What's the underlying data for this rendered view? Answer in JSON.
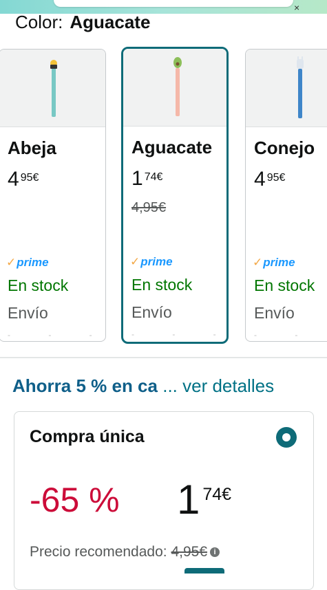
{
  "header": {
    "close_glyph": "×"
  },
  "color_selector": {
    "label": "Color:",
    "value": "Aguacate"
  },
  "variants": [
    {
      "name": "Abeja",
      "price_whole": "4",
      "price_frac": "95€",
      "strike_price": "",
      "prime": "prime",
      "stock": "En stock",
      "shipping": "Envío",
      "pen_color": "#78c8c4",
      "cap_color": "#f2c23a"
    },
    {
      "name": "Aguacate",
      "price_whole": "1",
      "price_frac": "74€",
      "strike_price": "4,95€",
      "prime": "prime",
      "stock": "En stock",
      "shipping": "Envío",
      "pen_color": "#f5b8a9",
      "cap_color": "#8dbf5a"
    },
    {
      "name": "Conejo",
      "price_whole": "4",
      "price_frac": "95€",
      "strike_price": "",
      "prime": "prime",
      "stock": "En stock",
      "shipping": "Envío",
      "pen_color": "#3f86c9",
      "cap_color": "#dfe6ee"
    }
  ],
  "promo": {
    "bold": "Ahorra 5 % en ca",
    "link": "... ver detalles"
  },
  "buybox": {
    "title": "Compra única",
    "discount": "-65 %",
    "price_whole": "1",
    "price_frac": "74€",
    "rrp_label": "Precio recomendado:",
    "rrp_value": "4,95€"
  },
  "colors": {
    "accent": "#0e6b78",
    "deal": "#cc0c39",
    "stock": "#007600",
    "prime": "#1a98ff",
    "link": "#007185"
  }
}
